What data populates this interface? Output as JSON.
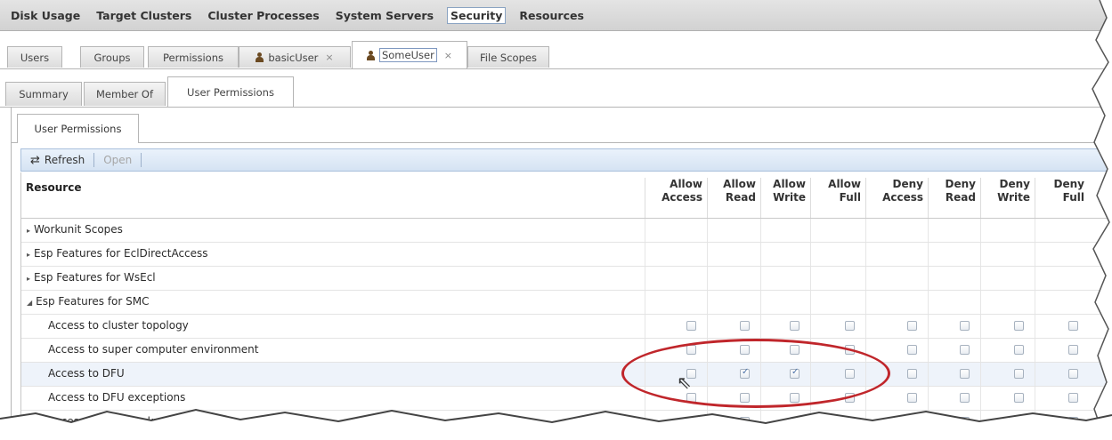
{
  "top_menu": [
    "Disk Usage",
    "Target Clusters",
    "Cluster Processes",
    "System Servers",
    "Security",
    "Resources"
  ],
  "top_menu_selected": "Security",
  "tabs2": {
    "users": "Users",
    "groups": "Groups",
    "permissions": "Permissions",
    "basic_user": "basicUser",
    "some_user": "SomeUser",
    "file_scopes": "File Scopes",
    "close_glyph": "×"
  },
  "tabs3": {
    "summary": "Summary",
    "member_of": "Member Of",
    "user_permissions": "User Permissions"
  },
  "inner_tab": "User Permissions",
  "toolbar": {
    "refresh": "Refresh",
    "open": "Open"
  },
  "grid": {
    "resource_header": "Resource",
    "columns": [
      {
        "l1": "Allow",
        "l2": "Access"
      },
      {
        "l1": "Allow",
        "l2": "Read"
      },
      {
        "l1": "Allow",
        "l2": "Write"
      },
      {
        "l1": "Allow",
        "l2": "Full"
      },
      {
        "l1": "Deny",
        "l2": "Access"
      },
      {
        "l1": "Deny",
        "l2": "Read"
      },
      {
        "l1": "Deny",
        "l2": "Write"
      },
      {
        "l1": "Deny",
        "l2": "Full"
      }
    ],
    "rows": [
      {
        "label": "Workunit Scopes",
        "group": true,
        "expanded": false
      },
      {
        "label": "Esp Features for EclDirectAccess",
        "group": true,
        "expanded": false
      },
      {
        "label": "Esp Features for WsEcl",
        "group": true,
        "expanded": false
      },
      {
        "label": "Esp Features for SMC",
        "group": true,
        "expanded": true
      },
      {
        "label": "Access to cluster topology",
        "group": false,
        "checks": [
          false,
          false,
          false,
          false,
          false,
          false,
          false,
          false
        ]
      },
      {
        "label": "Access to super computer environment",
        "group": false,
        "checks": [
          false,
          false,
          false,
          false,
          false,
          false,
          false,
          false
        ]
      },
      {
        "label": "Access to DFU",
        "group": false,
        "selected": true,
        "checks": [
          false,
          true,
          true,
          false,
          false,
          false,
          false,
          false
        ]
      },
      {
        "label": "Access to DFU exceptions",
        "group": false,
        "checks": [
          false,
          false,
          false,
          false,
          false,
          false,
          false,
          false
        ]
      },
      {
        "label": "Access to DFU workunits",
        "group": false,
        "checks": [
          false,
          false,
          false,
          false,
          false,
          false,
          false,
          false
        ]
      }
    ]
  },
  "colors": {
    "annotation_oval": "#c0262b",
    "toolbar_bg": "#dce8f5"
  }
}
